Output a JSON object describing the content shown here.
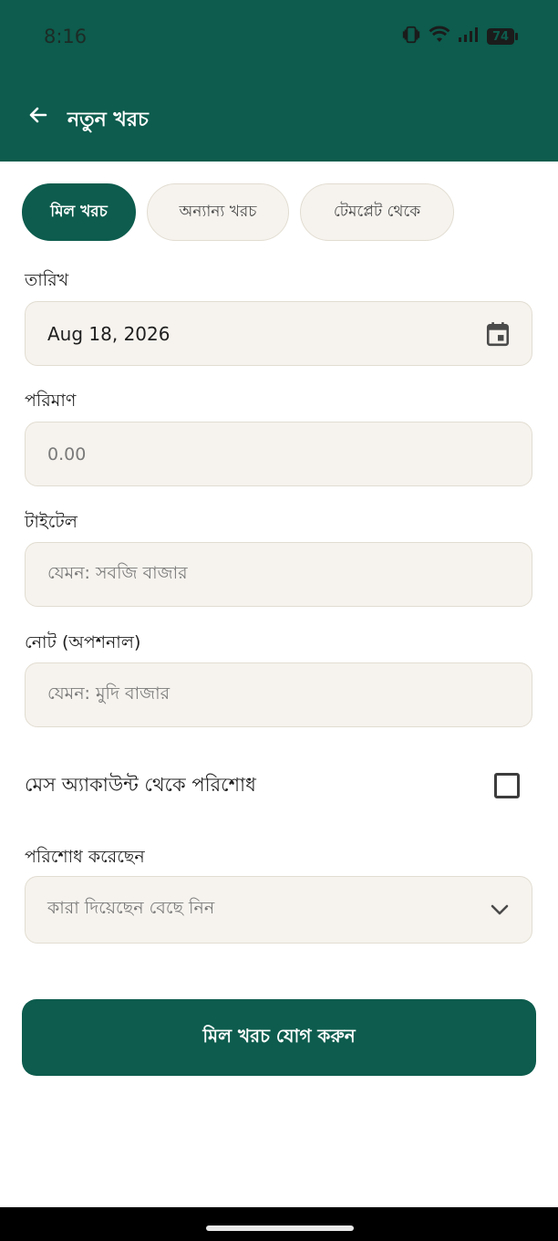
{
  "status_bar": {
    "time": "8:16",
    "battery_level": "74",
    "icons": [
      "vibrate-icon",
      "wifi-icon",
      "signal-icon",
      "battery-icon"
    ]
  },
  "app_bar": {
    "title": "নতুন খরচ",
    "back_icon": "arrow-back-icon"
  },
  "tabs": [
    {
      "label": "মিল খরচ",
      "active": true
    },
    {
      "label": "অন্যান্য খরচ",
      "active": false
    },
    {
      "label": "টেমপ্লেট থেকে",
      "active": false
    }
  ],
  "form": {
    "date": {
      "label": "তারিখ",
      "value": "Aug 18, 2026",
      "icon": "calendar-icon"
    },
    "amount": {
      "label": "পরিমাণ",
      "placeholder": "0.00"
    },
    "title": {
      "label": "টাইটেল",
      "placeholder": "যেমন: সবজি বাজার"
    },
    "note": {
      "label": "নোট (অপশনাল)",
      "placeholder": "যেমন: মুদি বাজার"
    },
    "mess_account": {
      "label": "মেস অ্যাকাউন্ট থেকে পরিশোধ",
      "checked": false
    },
    "paid_by": {
      "label": "পরিশোধ করেছেন",
      "placeholder": "কারা দিয়েছেন বেছে নিন",
      "icon": "chevron-down-icon"
    }
  },
  "submit": {
    "label": "মিল খরচ যোগ করুন"
  },
  "colors": {
    "primary": "#0d5c4d",
    "field_background": "#f6f3ee",
    "field_border": "#e2ddd2"
  }
}
